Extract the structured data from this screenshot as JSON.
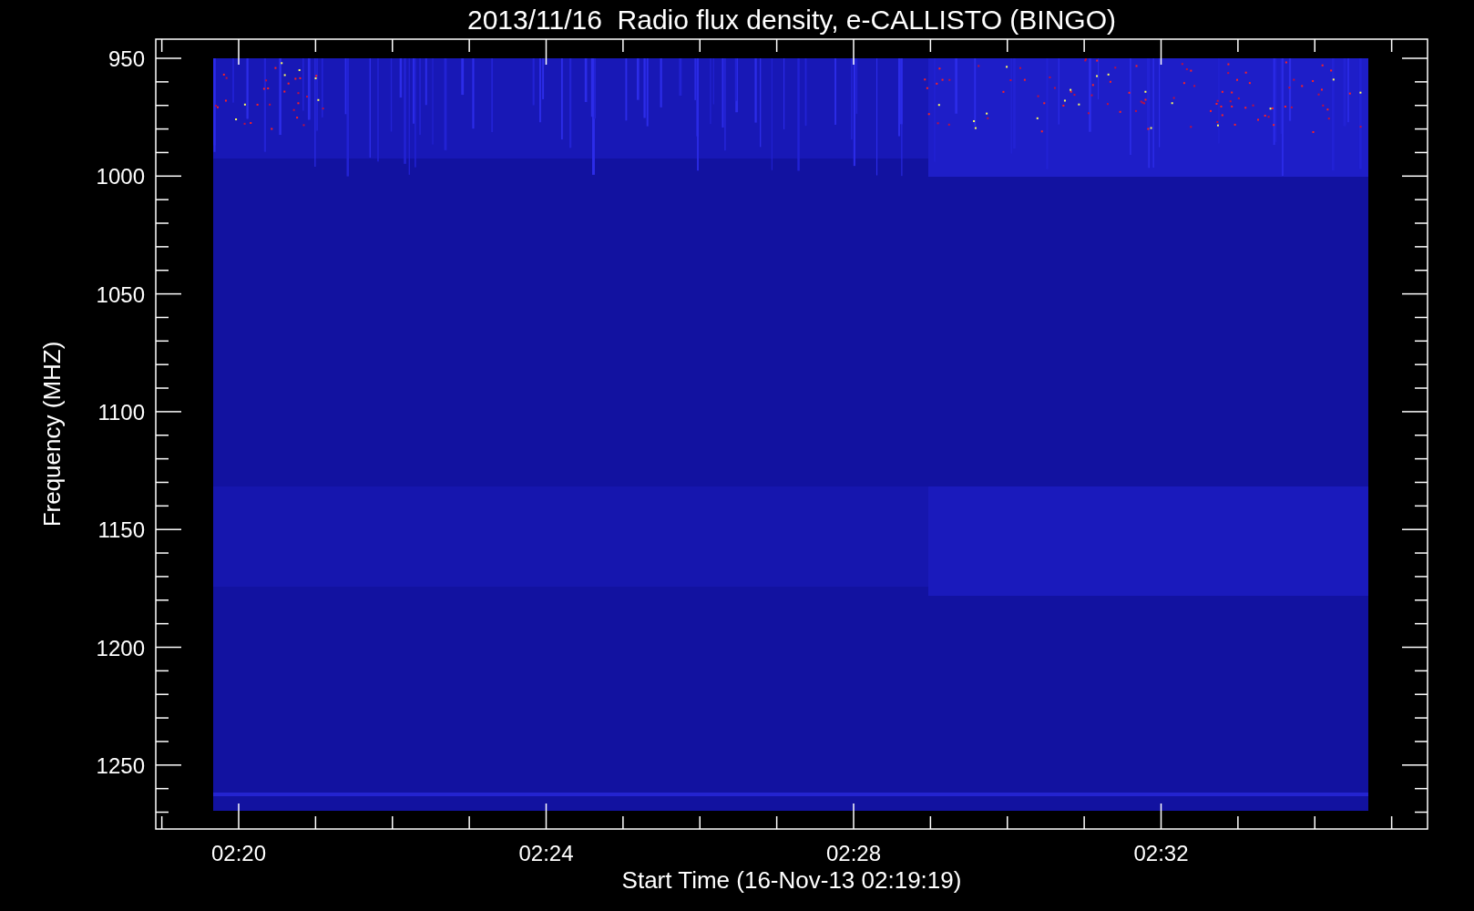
{
  "plot": {
    "title": "2013/11/16  Radio flux density, e-CALLISTO (BINGO)",
    "ylabel": "Frequency (MHZ)",
    "xlabel": "Start Time (16-Nov-13 02:19:19)",
    "y_tick_labels": [
      "950",
      "1000",
      "1050",
      "1100",
      "1150",
      "1200",
      "1250"
    ],
    "x_tick_labels": [
      "02:20",
      "02:24",
      "02:28",
      "02:32"
    ]
  }
}
